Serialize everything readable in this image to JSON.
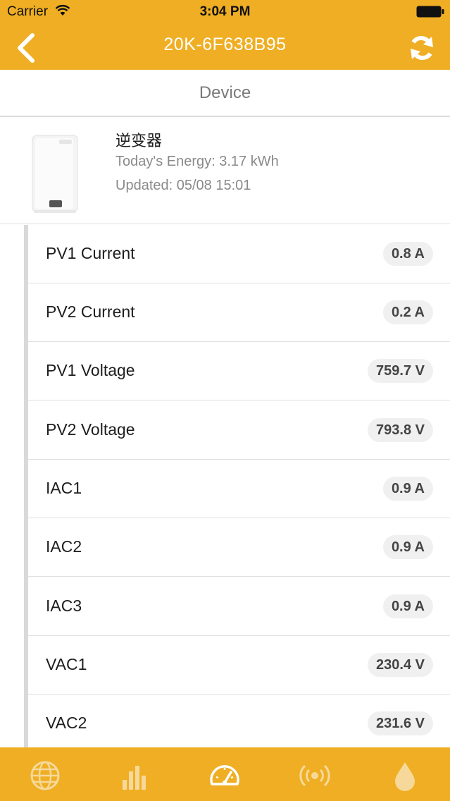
{
  "status_bar": {
    "carrier": "Carrier",
    "time": "3:04 PM"
  },
  "nav": {
    "title": "20K-6F638B95",
    "back_icon": "chevron-left-icon",
    "refresh_icon": "refresh-icon"
  },
  "section": {
    "title": "Device"
  },
  "device": {
    "name": "逆变器",
    "energy": "Today's Energy: 3.17 kWh",
    "updated": "Updated: 05/08 15:01"
  },
  "metrics": [
    {
      "label": "PV1 Current",
      "value": "0.8 A"
    },
    {
      "label": "PV2 Current",
      "value": "0.2 A"
    },
    {
      "label": "PV1 Voltage",
      "value": "759.7 V"
    },
    {
      "label": "PV2 Voltage",
      "value": "793.8 V"
    },
    {
      "label": "IAC1",
      "value": "0.9 A"
    },
    {
      "label": "IAC2",
      "value": "0.9 A"
    },
    {
      "label": "IAC3",
      "value": "0.9 A"
    },
    {
      "label": "VAC1",
      "value": "230.4 V"
    },
    {
      "label": "VAC2",
      "value": "231.6 V"
    }
  ],
  "tabs": [
    {
      "icon": "globe-icon"
    },
    {
      "icon": "bar-chart-icon"
    },
    {
      "icon": "gauge-icon"
    },
    {
      "icon": "signal-icon"
    },
    {
      "icon": "water-drop-icon"
    }
  ],
  "colors": {
    "accent": "#EFAE23",
    "tab_icon": "#F6D99A"
  }
}
